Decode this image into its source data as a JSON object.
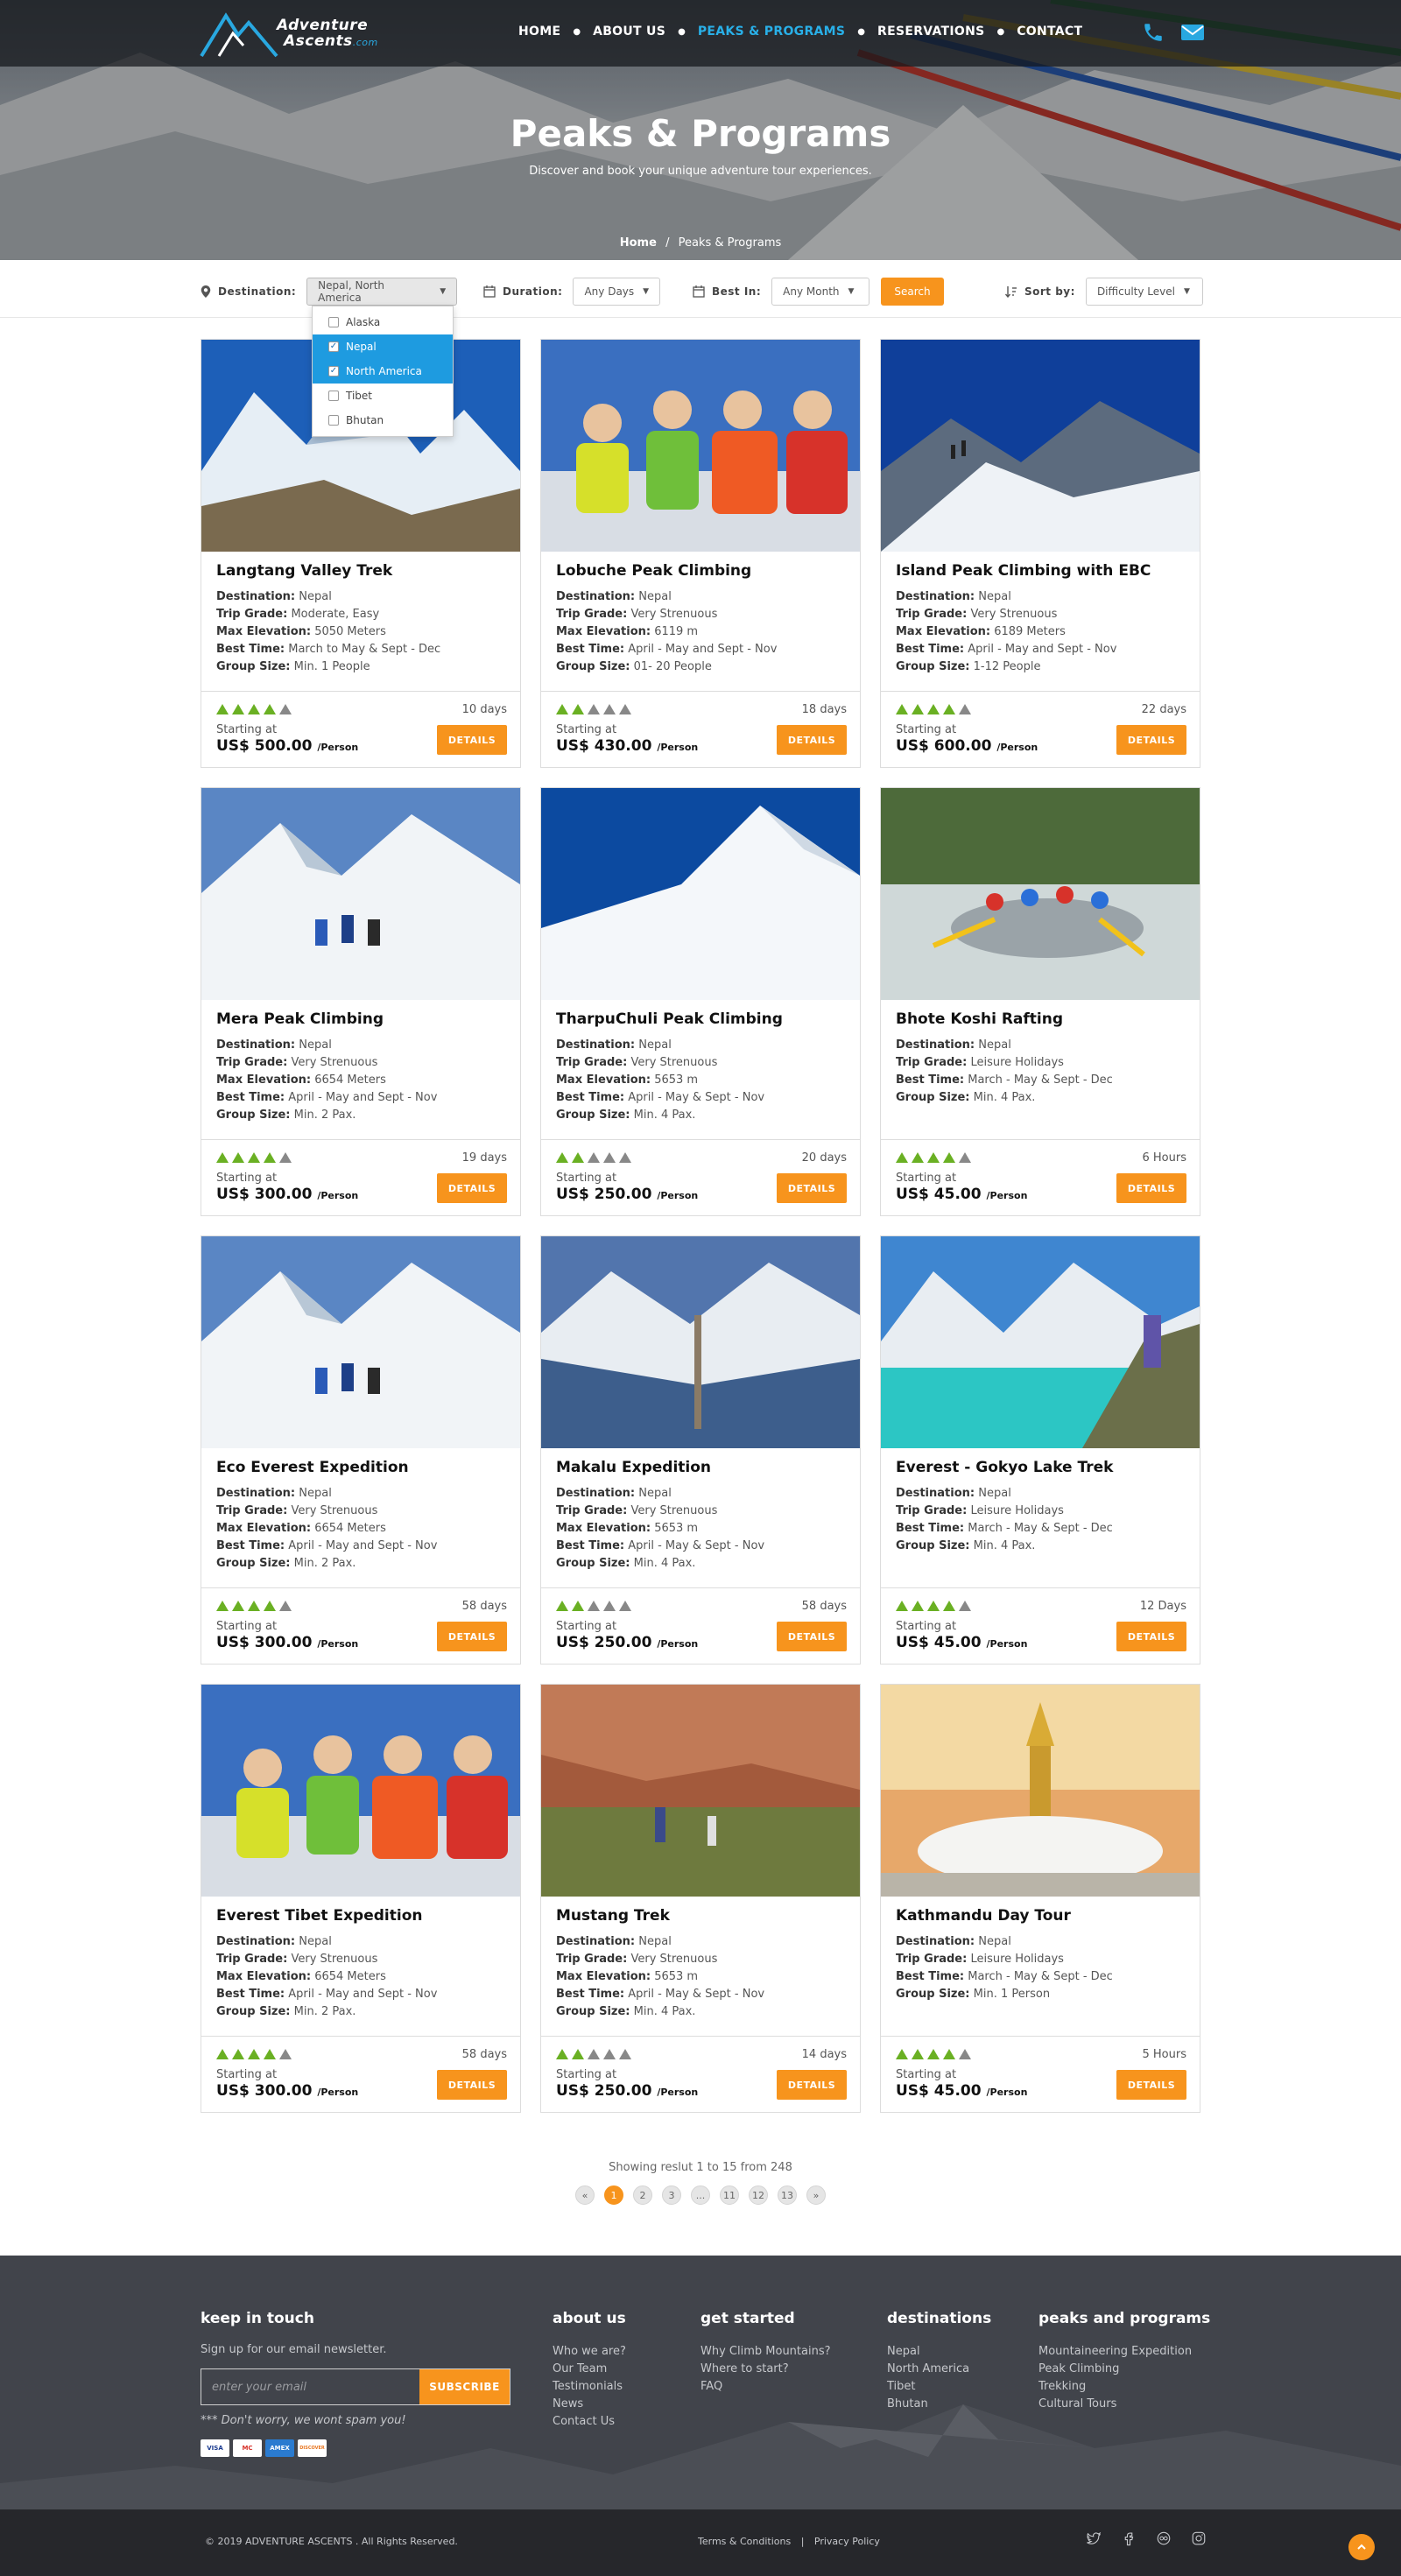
{
  "brand": {
    "line1": "Adventure",
    "line2": "Ascents",
    "domain": ".com"
  },
  "nav": [
    "HOME",
    "ABOUT US",
    "PEAKS & PROGRAMS",
    "RESERVATIONS",
    "CONTACT"
  ],
  "nav_active": "PEAKS & PROGRAMS",
  "hero": {
    "title": "Peaks & Programs",
    "subtitle": "Discover and book your unique adventure tour experiences.",
    "breadcrumb_home": "Home",
    "breadcrumb_sep": "/",
    "breadcrumb_current": "Peaks & Programs"
  },
  "filters": {
    "destination_label": "Destination:",
    "destination_value": "Nepal, North America",
    "duration_label": "Duration:",
    "duration_value": "Any Days",
    "best_in_label": "Best In:",
    "best_in_value": "Any Month",
    "search_label": "Search",
    "sort_label": "Sort by:",
    "sort_value": "Difficulty Level",
    "dropdown_options": [
      {
        "label": "Alaska",
        "checked": false
      },
      {
        "label": "Nepal",
        "checked": true
      },
      {
        "label": "North America",
        "checked": true
      },
      {
        "label": "Tibet",
        "checked": false
      },
      {
        "label": "Bhutan",
        "checked": false
      }
    ]
  },
  "card_labels": {
    "destination": "Destination:",
    "grade": "Trip Grade:",
    "elevation": "Max Elevation:",
    "best": "Best Time:",
    "group": "Group Size:",
    "starting": "Starting at",
    "per": "/Person",
    "details": "DETAILS"
  },
  "programs": [
    {
      "title": "Langtang Valley Trek",
      "destination": "Nepal",
      "grade": "Moderate, Easy",
      "elevation": "5050 Meters",
      "best": "March to May & Sept - Dec",
      "group": "Min. 1 People",
      "rating": 4,
      "duration": "10 days",
      "price": "US$ 500.00",
      "scene": "mountain"
    },
    {
      "title": "Lobuche Peak Climbing",
      "destination": "Nepal",
      "grade": "Very Strenuous",
      "elevation": "6119 m",
      "best": "April - May and Sept - Nov",
      "group": "01- 20 People",
      "rating": 2,
      "duration": "18 days",
      "price": "US$ 430.00",
      "scene": "people"
    },
    {
      "title": "Island Peak Climbing with EBC",
      "destination": "Nepal",
      "grade": "Very Strenuous",
      "elevation": "6189 Meters",
      "best": "April - May and Sept - Nov",
      "group": "1-12 People",
      "rating": 4,
      "duration": "22 days",
      "price": "US$ 600.00",
      "scene": "ridge"
    },
    {
      "title": "Mera Peak Climbing",
      "destination": "Nepal",
      "grade": "Very Strenuous",
      "elevation": "6654 Meters",
      "best": "April - May and Sept - Nov",
      "group": "Min. 2 Pax.",
      "rating": 4,
      "duration": "19 days",
      "price": "US$ 300.00",
      "scene": "snow-climbers"
    },
    {
      "title": "TharpuChuli Peak Climbing",
      "destination": "Nepal",
      "grade": "Very Strenuous",
      "elevation": "5653 m",
      "best": "April - May & Sept - Nov",
      "group": "Min. 4 Pax.",
      "rating": 2,
      "duration": "20 days",
      "price": "US$ 250.00",
      "scene": "snowpeak"
    },
    {
      "title": "Bhote Koshi Rafting",
      "destination": "Nepal",
      "grade": "Leisure Holidays",
      "elevation": "",
      "best": "March - May & Sept - Dec",
      "group": "Min. 4 Pax.",
      "rating": 4,
      "duration": "6 Hours",
      "price": "US$ 45.00",
      "scene": "rafting"
    },
    {
      "title": "Eco Everest Expedition",
      "destination": "Nepal",
      "grade": "Very Strenuous",
      "elevation": "6654 Meters",
      "best": "April - May and Sept - Nov",
      "group": "Min. 2 Pax.",
      "rating": 4,
      "duration": "58 days",
      "price": "US$ 300.00",
      "scene": "snow-climbers"
    },
    {
      "title": "Makalu Expedition",
      "destination": "Nepal",
      "grade": "Very Strenuous",
      "elevation": "5653 m",
      "best": "April - May & Sept - Nov",
      "group": "Min. 4 Pax.",
      "rating": 2,
      "duration": "58 days",
      "price": "US$ 250.00",
      "scene": "valley"
    },
    {
      "title": "Everest - Gokyo Lake Trek",
      "destination": "Nepal",
      "grade": "Leisure Holidays",
      "elevation": "",
      "best": "March - May & Sept - Dec",
      "group": "Min. 4 Pax.",
      "rating": 4,
      "duration": "12 Days",
      "price": "US$ 45.00",
      "scene": "lake"
    },
    {
      "title": "Everest Tibet Expedition",
      "destination": "Nepal",
      "grade": "Very Strenuous",
      "elevation": "6654 Meters",
      "best": "April - May and Sept - Nov",
      "group": "Min. 2 Pax.",
      "rating": 4,
      "duration": "58 days",
      "price": "US$ 300.00",
      "scene": "people"
    },
    {
      "title": "Mustang Trek",
      "destination": "Nepal",
      "grade": "Very Strenuous",
      "elevation": "5653 m",
      "best": "April - May & Sept - Nov",
      "group": "Min. 4 Pax.",
      "rating": 2,
      "duration": "14 days",
      "price": "US$ 250.00",
      "scene": "canyon"
    },
    {
      "title": "Kathmandu Day Tour",
      "destination": "Nepal",
      "grade": "Leisure Holidays",
      "elevation": "",
      "best": "March - May & Sept - Dec",
      "group": "Min. 1 Person",
      "rating": 4,
      "duration": "5 Hours",
      "price": "US$ 45.00",
      "scene": "stupa"
    }
  ],
  "pagination": {
    "showing": "Showing reslut 1 to 15 from 248",
    "pages": [
      "«",
      "1",
      "2",
      "3",
      "...",
      "11",
      "12",
      "13",
      "»"
    ],
    "current": "1"
  },
  "footer": {
    "keep_title": "keep in touch",
    "keep_text": "Sign up for our email newsletter.",
    "email_placeholder": "enter your email",
    "subscribe": "SUBSCRIBE",
    "spam_note": "*** Don't worry, we wont spam you!",
    "about_title": "about us",
    "about_links": [
      "Who we are?",
      "Our Team",
      "Testimonials",
      "News",
      "Contact Us"
    ],
    "started_title": "get started",
    "started_links": [
      "Why Climb Mountains?",
      "Where to start?",
      "FAQ"
    ],
    "dest_title": "destinations",
    "dest_links": [
      "Nepal",
      "North America",
      "Tibet",
      "Bhutan"
    ],
    "peaks_title": "peaks and programs",
    "peaks_links": [
      "Mountaineering Expedition",
      "Peak Climbing",
      "Trekking",
      "Cultural Tours"
    ],
    "pay_cards": [
      "VISA",
      "MC",
      "AMEX",
      "DISCOVER"
    ],
    "copyright": "© 2019 ADVENTURE ASCENTS . All Rights Reserved.",
    "terms": "Terms & Conditions",
    "legal_sep": "|",
    "privacy": "Privacy Policy"
  },
  "colors": {
    "accent": "#f7941d",
    "nav_active": "#29b0e8",
    "rating_on": "#6ab023",
    "rating_off": "#888888",
    "footer_bg": "#41444b",
    "bottom_bg": "#26272b"
  }
}
